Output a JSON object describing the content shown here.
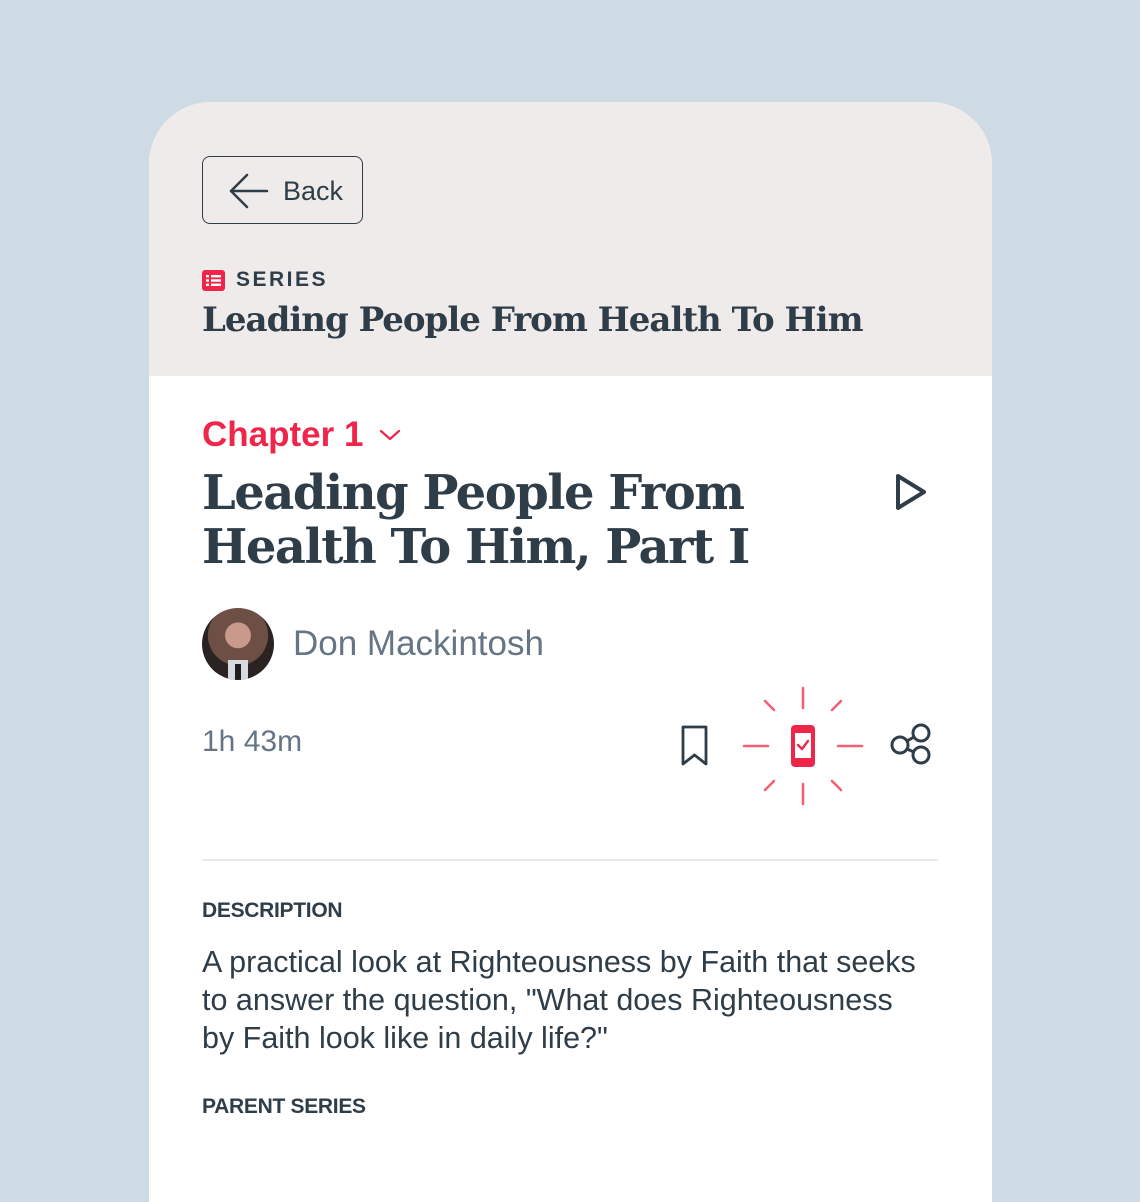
{
  "header": {
    "back_label": "Back",
    "series_kicker": "SERIES",
    "series_title": "Leading People From Health To Him"
  },
  "episode": {
    "chapter_label": "Chapter 1",
    "title_line1": "Leading People From",
    "title_line2": "Health To Him, Part I",
    "author": "Don Mackintosh",
    "duration": "1h 43m"
  },
  "sections": {
    "description_label": "DESCRIPTION",
    "description_text": "A practical look at Righteousness by Faith that seeks to answer the question, \"What does Righteousness by Faith look like in daily life?\"",
    "parent_series_label": "PARENT SERIES"
  },
  "icons": {
    "back": "arrow-left-icon",
    "series": "list-icon",
    "chapter_dropdown": "chevron-down-icon",
    "play": "play-icon",
    "bookmark": "bookmark-icon",
    "download": "device-check-icon",
    "share": "share-icon"
  },
  "colors": {
    "accent": "#f0254a",
    "text_primary": "#2f3d49",
    "text_secondary": "#667584",
    "header_bg": "#efebea",
    "page_bg": "#cfdbe4"
  }
}
